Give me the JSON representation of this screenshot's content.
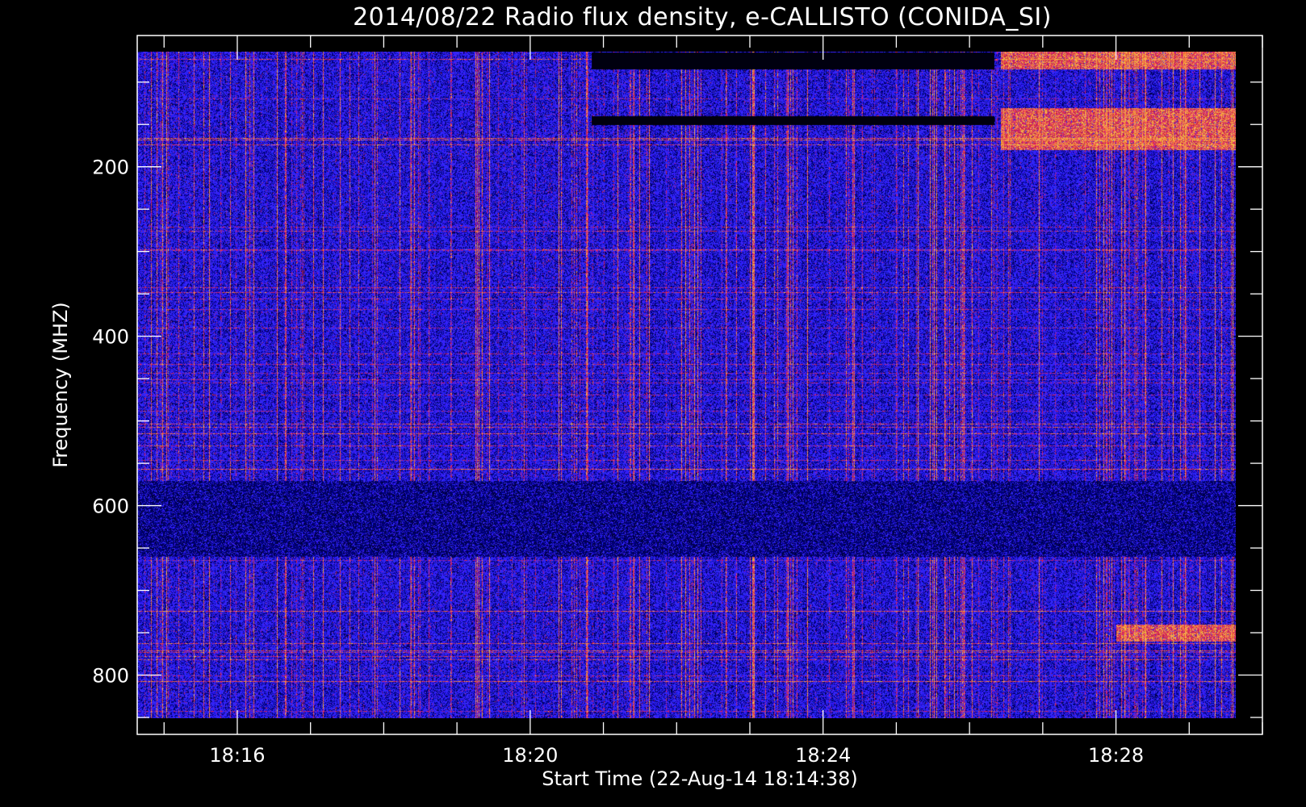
{
  "chart_data": {
    "type": "heatmap",
    "title": "2014/08/22  Radio flux density, e-CALLISTO (CONIDA_SI)",
    "xlabel": "Start Time (22-Aug-14 18:14:38)",
    "ylabel": "Frequency (MHZ)",
    "x_ticks": [
      "18:16",
      "18:20",
      "18:24",
      "18:28"
    ],
    "y_ticks": [
      "200",
      "400",
      "600",
      "800"
    ],
    "xlim": [
      "18:14:38",
      "18:30:00"
    ],
    "ylim": [
      45,
      870
    ],
    "y_inverted": true,
    "data_time_range": [
      "18:14:38",
      "18:29:38"
    ],
    "colormap": [
      "#000000",
      "#1010c0",
      "#2020ff",
      "#d02020",
      "#ffd060"
    ],
    "background_color": "#000000",
    "foreground_color": "#ffffff",
    "features": [
      {
        "kind": "quiet band",
        "freq_range": [
          570,
          660
        ]
      },
      {
        "kind": "interference",
        "freq_range": [
          45,
          85
        ],
        "time_range": [
          "18:26:25",
          "18:29:38"
        ]
      },
      {
        "kind": "interference",
        "freq_range": [
          130,
          180
        ],
        "time_range": [
          "18:26:25",
          "18:29:38"
        ]
      },
      {
        "kind": "interference",
        "freq_range": [
          740,
          760
        ],
        "time_range": [
          "18:28:00",
          "18:29:38"
        ]
      },
      {
        "kind": "gap",
        "freq_range": [
          140,
          150
        ],
        "time_range": [
          "18:20:50",
          "18:26:20"
        ]
      },
      {
        "kind": "gap",
        "freq_range": [
          65,
          85
        ],
        "time_range": [
          "18:20:50",
          "18:26:20"
        ]
      }
    ]
  }
}
